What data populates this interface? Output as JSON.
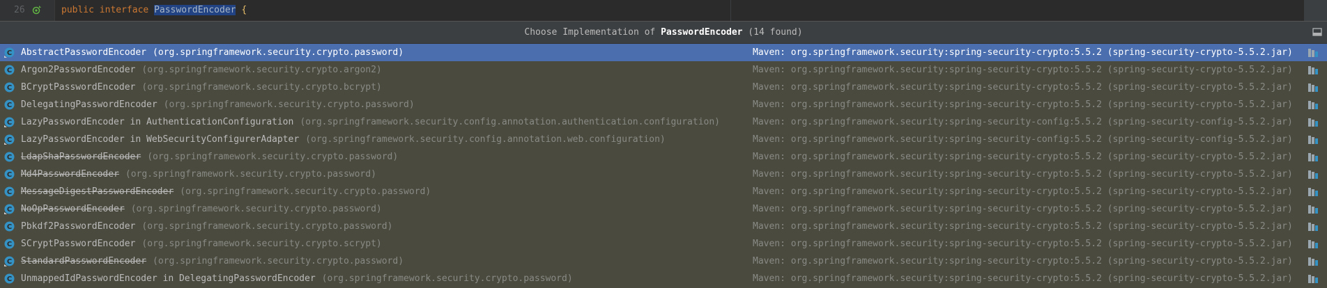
{
  "editor": {
    "line_number": "26",
    "code": {
      "kw1": "public",
      "kw2": "interface",
      "name": "PasswordEncoder",
      "brace": "{"
    }
  },
  "popup": {
    "title_prefix": "Choose Implementation of ",
    "title_name": "PasswordEncoder",
    "title_suffix": " (14 found)",
    "rows": [
      {
        "name": "AbstractPasswordEncoder",
        "pkg": "(org.springframework.security.crypto.password)",
        "maven": "Maven: org.springframework.security:spring-security-crypto:5.5.2 (spring-security-crypto-5.5.2.jar)"
      },
      {
        "name": "Argon2PasswordEncoder",
        "pkg": "(org.springframework.security.crypto.argon2)",
        "maven": "Maven: org.springframework.security:spring-security-crypto:5.5.2 (spring-security-crypto-5.5.2.jar)"
      },
      {
        "name": "BCryptPasswordEncoder",
        "pkg": "(org.springframework.security.crypto.bcrypt)",
        "maven": "Maven: org.springframework.security:spring-security-crypto:5.5.2 (spring-security-crypto-5.5.2.jar)"
      },
      {
        "name": "DelegatingPasswordEncoder",
        "pkg": "(org.springframework.security.crypto.password)",
        "maven": "Maven: org.springframework.security:spring-security-crypto:5.5.2 (spring-security-crypto-5.5.2.jar)"
      },
      {
        "name": "LazyPasswordEncoder in AuthenticationConfiguration",
        "pkg": "(org.springframework.security.config.annotation.authentication.configuration)",
        "maven": "Maven: org.springframework.security:spring-security-config:5.5.2 (spring-security-config-5.5.2.jar)"
      },
      {
        "name": "LazyPasswordEncoder in WebSecurityConfigurerAdapter",
        "pkg": "(org.springframework.security.config.annotation.web.configuration)",
        "maven": "Maven: org.springframework.security:spring-security-config:5.5.2 (spring-security-config-5.5.2.jar)"
      },
      {
        "name": "LdapShaPasswordEncoder",
        "pkg": "(org.springframework.security.crypto.password)",
        "maven": "Maven: org.springframework.security:spring-security-crypto:5.5.2 (spring-security-crypto-5.5.2.jar)"
      },
      {
        "name": "Md4PasswordEncoder",
        "pkg": "(org.springframework.security.crypto.password)",
        "maven": "Maven: org.springframework.security:spring-security-crypto:5.5.2 (spring-security-crypto-5.5.2.jar)"
      },
      {
        "name": "MessageDigestPasswordEncoder",
        "pkg": "(org.springframework.security.crypto.password)",
        "maven": "Maven: org.springframework.security:spring-security-crypto:5.5.2 (spring-security-crypto-5.5.2.jar)"
      },
      {
        "name": "NoOpPasswordEncoder",
        "pkg": "(org.springframework.security.crypto.password)",
        "maven": "Maven: org.springframework.security:spring-security-crypto:5.5.2 (spring-security-crypto-5.5.2.jar)"
      },
      {
        "name": "Pbkdf2PasswordEncoder",
        "pkg": "(org.springframework.security.crypto.password)",
        "maven": "Maven: org.springframework.security:spring-security-crypto:5.5.2 (spring-security-crypto-5.5.2.jar)"
      },
      {
        "name": "SCryptPasswordEncoder",
        "pkg": "(org.springframework.security.crypto.scrypt)",
        "maven": "Maven: org.springframework.security:spring-security-crypto:5.5.2 (spring-security-crypto-5.5.2.jar)"
      },
      {
        "name": "StandardPasswordEncoder",
        "pkg": "(org.springframework.security.crypto.password)",
        "maven": "Maven: org.springframework.security:spring-security-crypto:5.5.2 (spring-security-crypto-5.5.2.jar)"
      },
      {
        "name": "UnmappedIdPasswordEncoder in DelegatingPasswordEncoder",
        "pkg": "(org.springframework.security.crypto.password)",
        "maven": "Maven: org.springframework.security:spring-security-crypto:5.5.2 (spring-security-crypto-5.5.2.jar)"
      }
    ]
  },
  "colors": {
    "selection": "#4b6eaf",
    "popup_bg": "#4b4a3e",
    "class_icon": "#3592c4",
    "keyword": "#cc7832"
  },
  "icons": {
    "class": "class-icon",
    "library": "library-icon",
    "pin": "pin-icon",
    "implement": "implementation-gutter-icon"
  }
}
